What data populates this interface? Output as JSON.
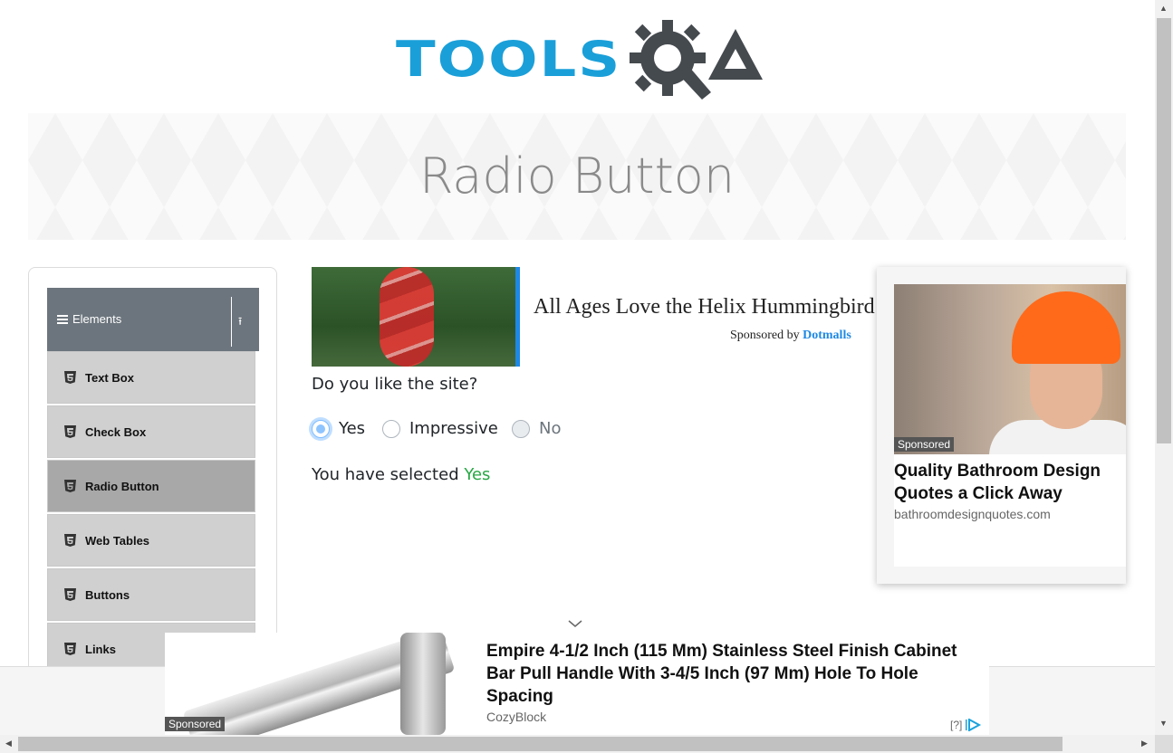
{
  "header": {
    "logo_text": "TOOLS"
  },
  "banner": {
    "title": "Radio Button"
  },
  "sidebar": {
    "group": "Elements",
    "items": [
      {
        "label": "Text Box"
      },
      {
        "label": "Check Box"
      },
      {
        "label": "Radio Button",
        "active": true
      },
      {
        "label": "Web Tables"
      },
      {
        "label": "Buttons"
      },
      {
        "label": "Links"
      }
    ]
  },
  "ad_top": {
    "title": "All Ages Love the Helix Hummingbird",
    "sponsored_by": "Sponsored by",
    "brand": "Dotmalls"
  },
  "main": {
    "question": "Do you like the site?",
    "options": [
      {
        "label": "Yes",
        "state": "checked"
      },
      {
        "label": "Impressive",
        "state": "unchecked"
      },
      {
        "label": "No",
        "state": "disabled"
      }
    ],
    "result_prefix": "You have selected ",
    "result_value": "Yes"
  },
  "ad_right": {
    "tag": "Sponsored",
    "title": "Quality Bathroom Design Quotes a Click Away",
    "domain": "bathroomdesignquotes.com"
  },
  "ad_bottom": {
    "tag": "Sponsored",
    "title": "Empire 4-1/2 Inch (115 Mm) Stainless Steel Finish Cabinet Bar Pull Handle With 3-4/5 Inch (97 Mm) Hole To Hole Spacing",
    "domain": "CozyBlock",
    "adchoices": "[?]"
  },
  "colors": {
    "logo_blue": "#1a9fd9",
    "logo_dark": "#454a4f",
    "sidebar_header": "#6c757d",
    "selected_value": "#28a745"
  }
}
